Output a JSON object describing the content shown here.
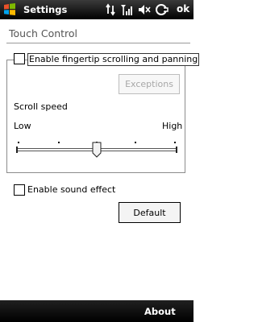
{
  "statusbar": {
    "title": "Settings",
    "ok_label": "ok"
  },
  "page": {
    "title": "Touch Control"
  },
  "finger_scroll": {
    "label": "Enable fingertip scrolling and panning",
    "checked": false,
    "exceptions_label": "Exceptions"
  },
  "scroll_speed": {
    "label": "Scroll speed",
    "low_label": "Low",
    "high_label": "High",
    "value_fraction": 0.5,
    "steps": 5
  },
  "sound_effect": {
    "label": "Enable sound effect",
    "checked": false
  },
  "buttons": {
    "default_label": "Default"
  },
  "softkeys": {
    "right_label": "About"
  },
  "colors": {
    "bar_background": "#000000",
    "disabled_text": "#a7a7a7"
  }
}
